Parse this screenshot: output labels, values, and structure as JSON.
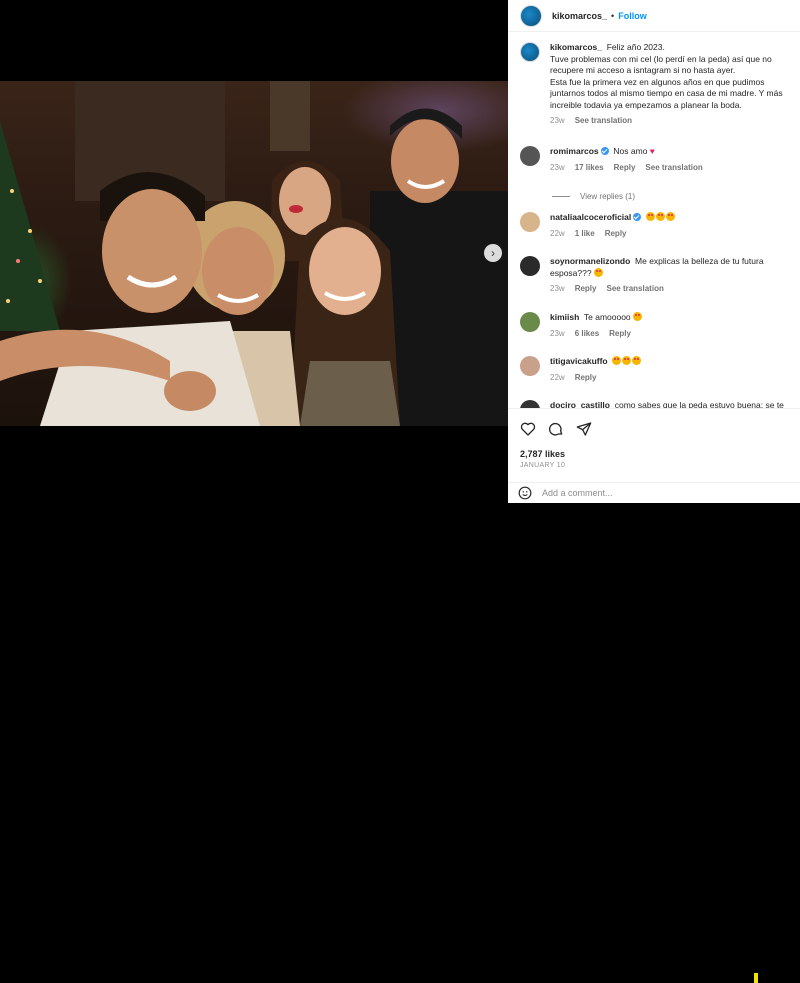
{
  "post": {
    "username": "kikomarcos_",
    "follow_label": "Follow",
    "caption_lines": [
      "Feliz año 2023.",
      "Tuve problemas con mi cel (lo perdí en la peda) así que no recupere mi acceso a isntagram si no hasta ayer.",
      "Esta fue la primera vez en algunos años en que pudimos juntarnos todos al mismo tiempo en casa de mi madre. Y más increible todavia ya empezamos a planear la boda."
    ],
    "caption_age": "23w",
    "see_translation": "See translation",
    "likes": "2,787 likes",
    "date": "JANUARY 10",
    "add_comment_placeholder": "Add a comment..."
  },
  "comments": [
    {
      "user": "romimarcos",
      "verified": true,
      "text": "Nos amo",
      "age": "23w",
      "likes": "17 likes",
      "reply": "Reply",
      "translation": "See translation",
      "avatar_color": "#4a4a4a",
      "emojis": "heart"
    },
    {
      "user": "nataliaalcoceroficial",
      "verified": true,
      "text": "",
      "age": "22w",
      "likes": "1 like",
      "reply": "Reply",
      "avatar_color": "#d8b48a",
      "emojis": "3 heart-eyes"
    },
    {
      "user": "soynormanelizondo",
      "verified": false,
      "text": "Me explicas la belleza de tu futura esposa???",
      "age": "23w",
      "reply": "Reply",
      "translation": "See translation",
      "avatar_color": "#2a2a2a",
      "emojis": "1 heart-eyes"
    },
    {
      "user": "kimiish",
      "verified": false,
      "text": "Te amooooo",
      "age": "23w",
      "likes": "6 likes",
      "reply": "Reply",
      "avatar_color": "#6a8a4a",
      "emojis": "1 heart-eyes"
    },
    {
      "user": "titigavicakuffo",
      "verified": false,
      "text": "",
      "age": "22w",
      "reply": "Reply",
      "avatar_color": "#c9a08a",
      "emojis": "3 heart-eyes"
    }
  ],
  "partial_comment": {
    "user": "dociro_castillo",
    "text": "como sabes que la peda estuvo buena: se te"
  },
  "view_replies": "View replies (1)",
  "colors": {
    "link": "#0095f6",
    "verified": "#3897f0",
    "heart": "#e0245e",
    "muted": "#8e8e8e"
  }
}
